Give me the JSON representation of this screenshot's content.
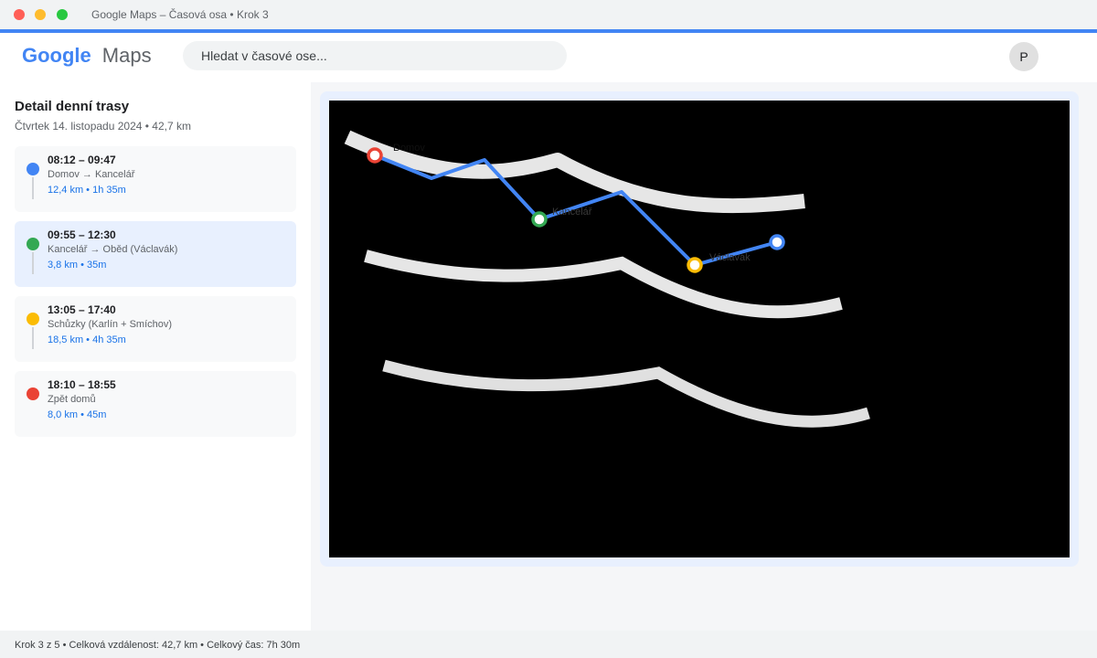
{
  "window": {
    "title": "Google Maps – Časová osa • Krok 3"
  },
  "header": {
    "logo_primary": "Google",
    "logo_secondary": "Maps",
    "search_placeholder": "Hledat v časové ose...",
    "avatar_initial": "P"
  },
  "sidebar": {
    "title": "Detail denní trasy",
    "subtitle": "Čtvrtek 14. listopadu 2024 • 42,7 km",
    "segments": [
      {
        "time": "08:12 – 09:47",
        "place": "Domov → Kancelář",
        "meta": "12,4 km • 1h 35m",
        "color": "#4285f4",
        "active": false
      },
      {
        "time": "09:55 – 12:30",
        "place": "Kancelář → Oběd (Václavák)",
        "meta": "3,8 km • 35m",
        "color": "#34a853",
        "active": true
      },
      {
        "time": "13:05 – 17:40",
        "place": "Schůzky (Karlín + Smíchov)",
        "meta": "18,5 km • 4h 35m",
        "color": "#fbbc04",
        "active": false
      },
      {
        "time": "18:10 – 18:55",
        "place": "Zpět domů",
        "meta": "8,0 km • 45m",
        "color": "#ea4335",
        "active": false
      }
    ]
  },
  "map": {
    "route_color": "#4285f4",
    "markers": [
      {
        "label": "Domov",
        "color": "#ea4335"
      },
      {
        "label": "Kancelář",
        "color": "#34a853"
      },
      {
        "label": "Václavák",
        "color": "#fbbc04"
      },
      {
        "label": "",
        "color": "#4285f4"
      }
    ]
  },
  "status": {
    "text": "Krok 3 z 5 • Celková vzdálenost: 42,7 km • Celkový čas: 7h 30m"
  }
}
